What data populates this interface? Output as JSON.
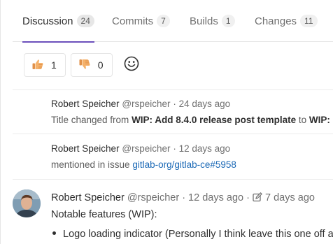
{
  "tabs": [
    {
      "label": "Discussion",
      "count": "24",
      "active": true
    },
    {
      "label": "Commits",
      "count": "7",
      "active": false
    },
    {
      "label": "Builds",
      "count": "1",
      "active": false
    },
    {
      "label": "Changes",
      "count": "11",
      "active": false
    }
  ],
  "awards": {
    "thumbsup": {
      "icon": "thumbs-up-icon",
      "count": "1"
    },
    "thumbsdown": {
      "icon": "thumbs-down-icon",
      "count": "0"
    },
    "add_icon": "smiley-icon"
  },
  "notes": [
    {
      "author": "Robert Speicher",
      "handle": "@rspeicher",
      "time": "· 24 days ago",
      "text_prefix": "Title changed from ",
      "from_title": "WIP: Add 8.4.0 release post template",
      "to_word": " to ",
      "to_title": "WIP: Re"
    },
    {
      "author": "Robert Speicher",
      "handle": "@rspeicher",
      "time": "· 12 days ago",
      "text_prefix": "mentioned in issue ",
      "link": "gitlab-org/gitlab-ce#5958"
    }
  ],
  "comment": {
    "author": "Robert Speicher",
    "handle": "@rspeicher",
    "time": "· 12 days ago ·",
    "edit_icon": "edit-icon",
    "edited": "7 days ago",
    "body": "Notable features (WIP):",
    "list": [
      "Logo loading indicator (Personally I think leave this one off an"
    ]
  },
  "colors": {
    "active_tab_underline": "#6b4fbb",
    "link": "#1b69b6",
    "thumb": "#f2a65a"
  }
}
